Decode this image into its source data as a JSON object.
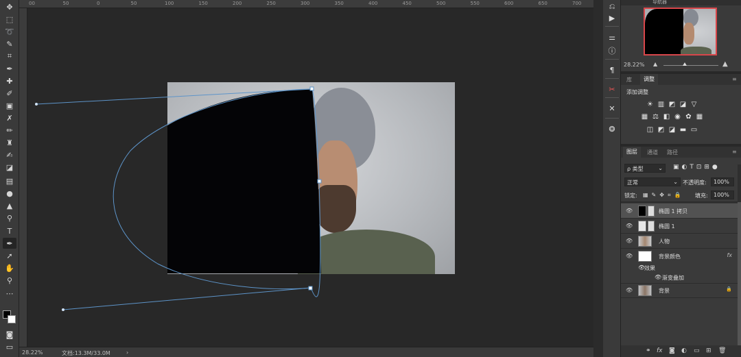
{
  "ruler": {
    "ticks": [
      "00",
      "50",
      "0",
      "50",
      "100",
      "150",
      "200",
      "250",
      "300",
      "350",
      "400",
      "450",
      "500",
      "550",
      "600",
      "650",
      "700"
    ]
  },
  "status": {
    "zoom": "28.22%",
    "doc": "文档:13.3M/33.0M",
    "arrow": "›"
  },
  "navigator": {
    "tab": "导航器",
    "zoom": "28.22%"
  },
  "adjustments": {
    "tab_library": "库",
    "tab_adjust": "调整",
    "title": "添加调整"
  },
  "layers": {
    "tabs": [
      "图层",
      "通道",
      "路径"
    ],
    "filter": "ρ 类型",
    "blend_mode": "正常",
    "opacity_label": "不透明度:",
    "opacity": "100%",
    "lock_label": "锁定:",
    "fill_label": "填充:",
    "fill": "100%",
    "items": [
      {
        "name": "椭圆 1 拷贝",
        "selected": true
      },
      {
        "name": "椭圆 1"
      },
      {
        "name": "人物"
      },
      {
        "name": "背景颜色",
        "fx": "fx"
      },
      {
        "name": "背景",
        "lock": "🔒"
      }
    ],
    "effects_label": "效果",
    "gradient_overlay": "渐变叠加"
  },
  "colors": {
    "accent": "#d9464a",
    "path": "#5d94c9"
  }
}
